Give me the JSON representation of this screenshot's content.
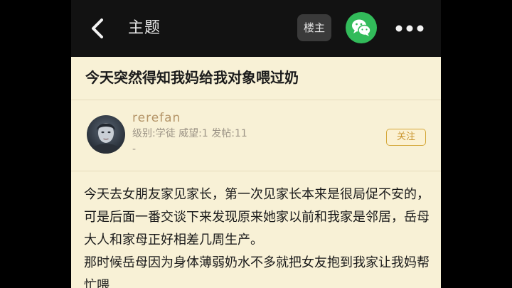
{
  "topbar": {
    "title": "主题",
    "op_label": "楼主",
    "back_icon": "chevron-left-icon",
    "share_icon": "wechat-icon",
    "more_icon": "more-horizontal-icon"
  },
  "post": {
    "title": "今天突然得知我妈给我对象喂过奶"
  },
  "author": {
    "name": "rerefan",
    "meta": "级别:学徒 威望:1 发帖:11",
    "extra": "-",
    "follow_label": "关注"
  },
  "body": {
    "paragraphs": [
      "今天去女朋友家见家长，第一次见家长本来是很局促不安的，可是后面一番交谈下来发现原来她家以前和我家是邻居，岳母大人和家母正好相差几周生产。",
      "那时候岳母因为身体薄弱奶水不多就把女友抱到我家让我妈帮忙喂"
    ]
  },
  "colors": {
    "background": "#f8f1d6",
    "topbar": "#121212",
    "wechat_green": "#32bb5a",
    "author_name": "#b49467",
    "follow_border": "#d4a83a"
  }
}
